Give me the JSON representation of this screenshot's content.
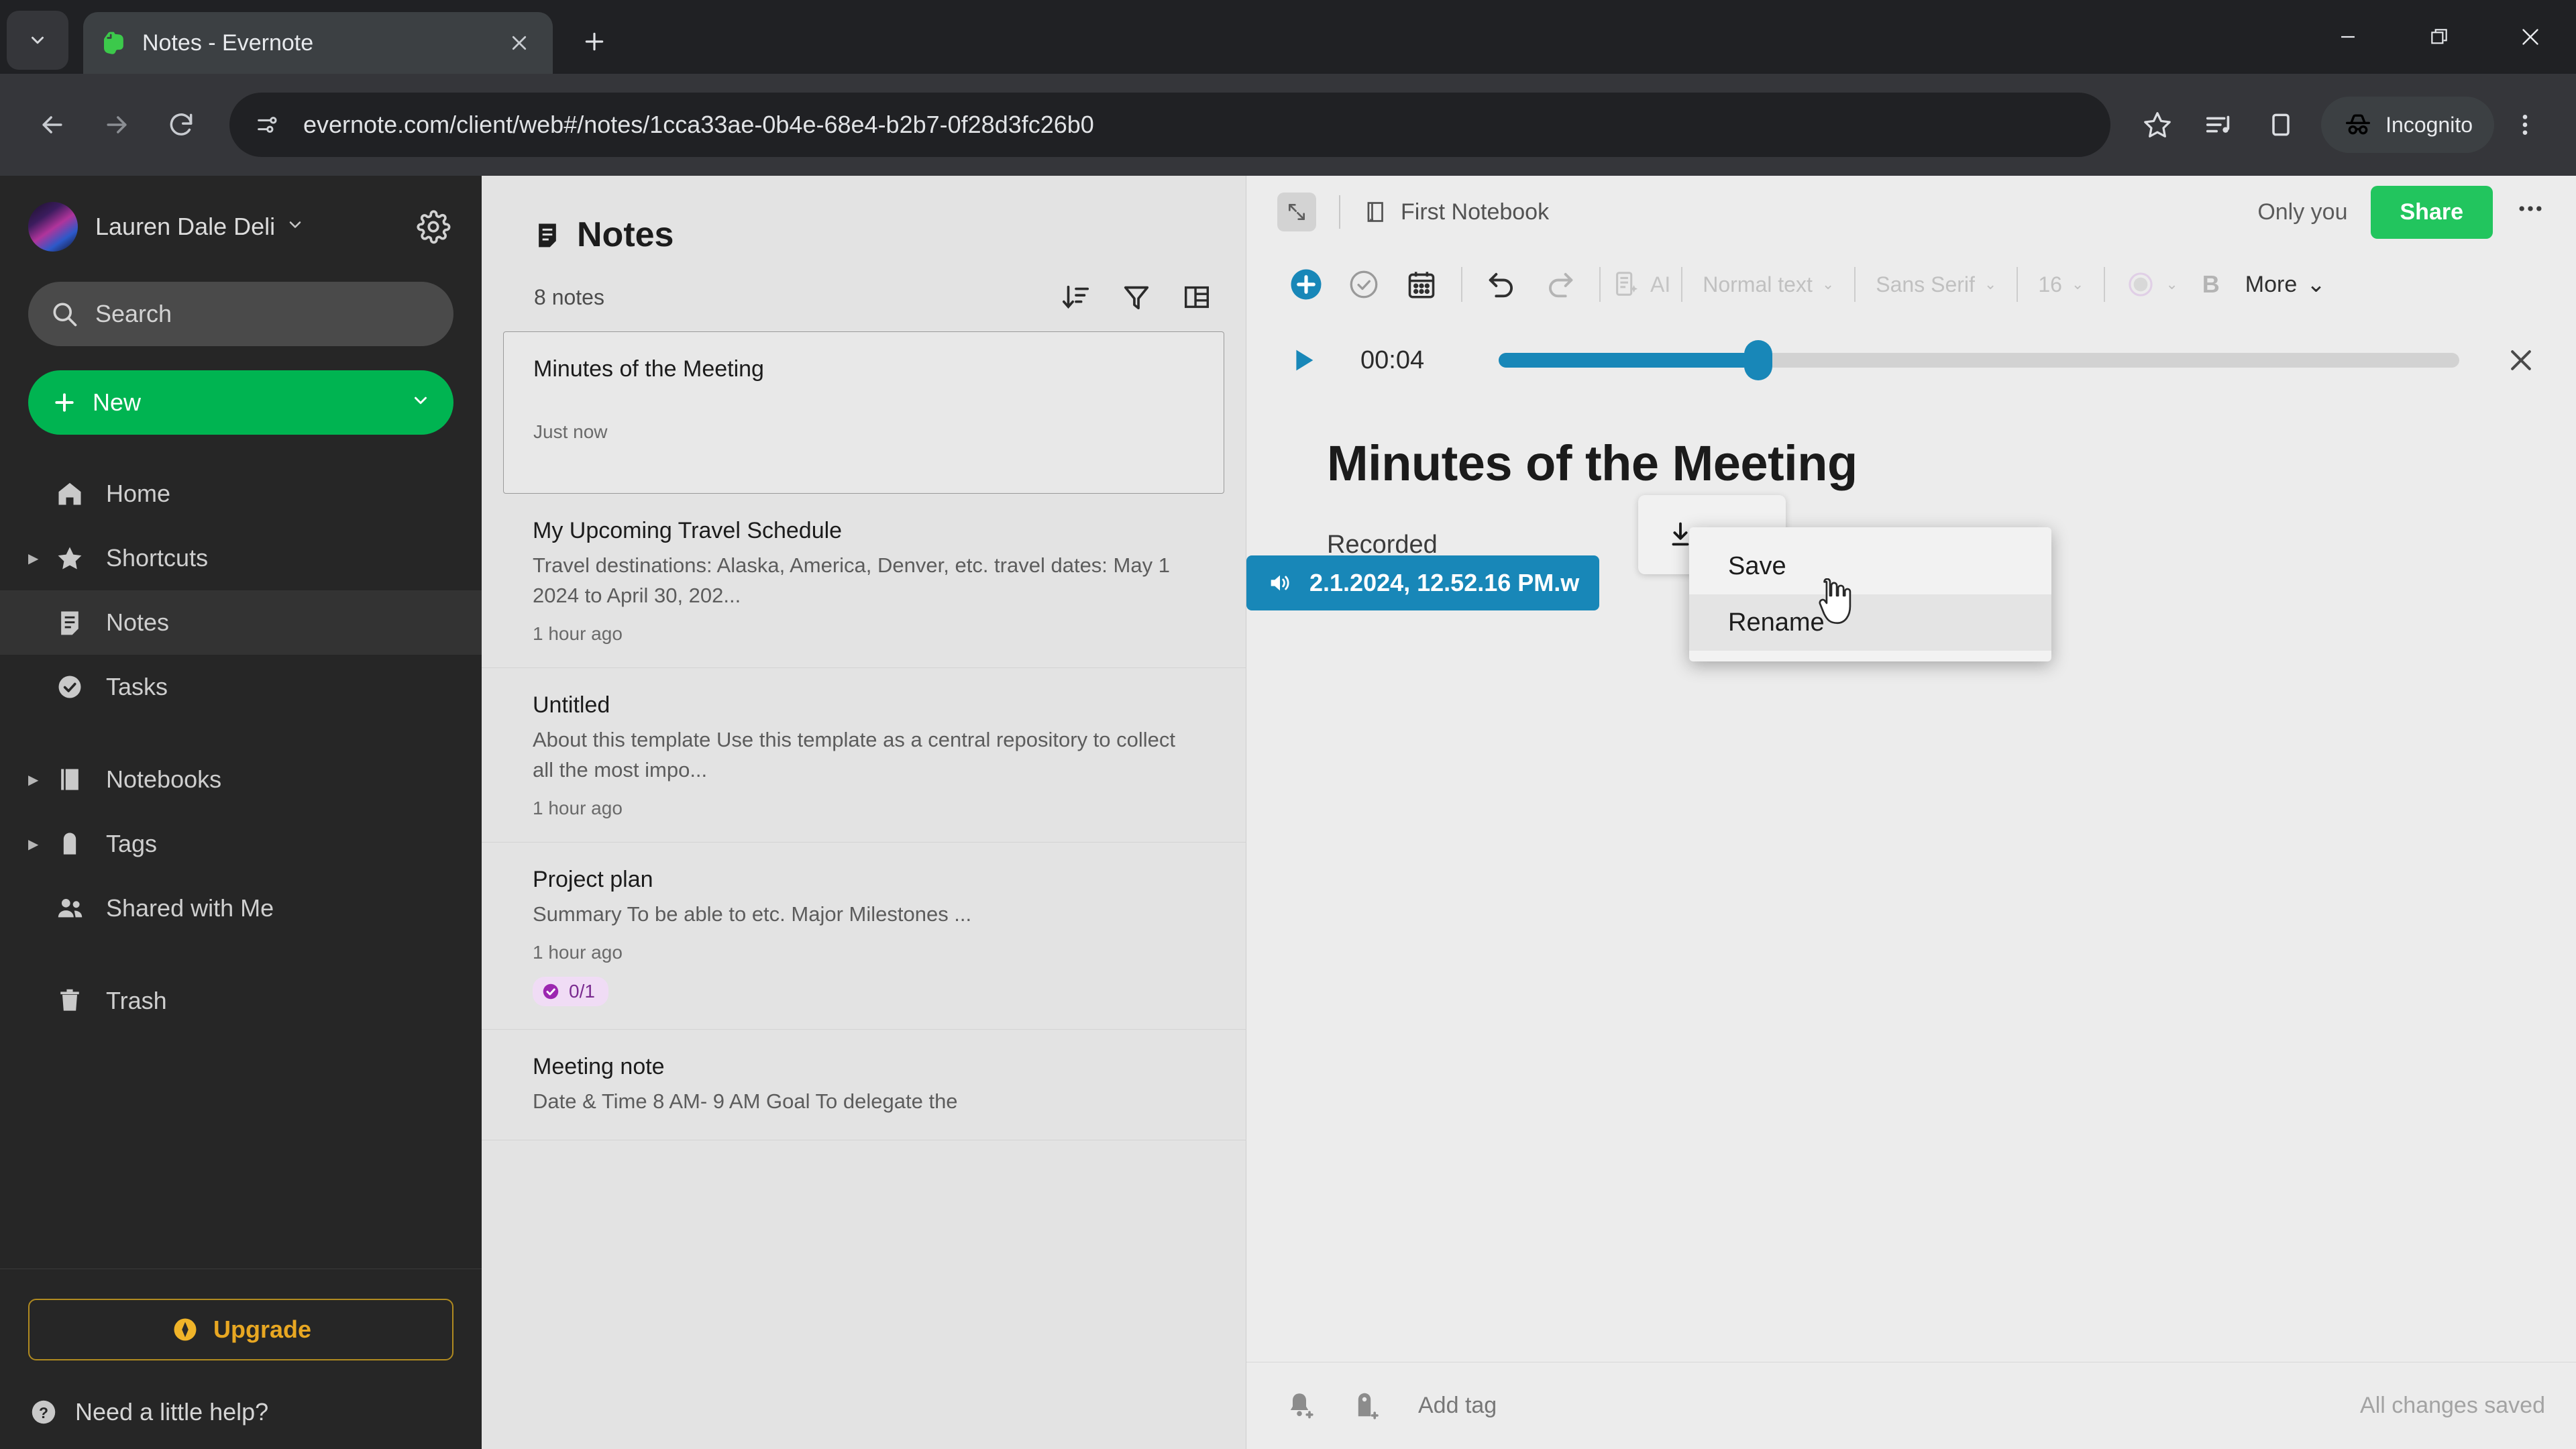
{
  "browser": {
    "tab": {
      "title": "Notes - Evernote",
      "favicon": "evernote-elephant-icon"
    },
    "new_tab_label": "+",
    "url": "evernote.com/client/web#/notes/1cca33ae-0b4e-68e4-b2b7-0f28d3fc26b0",
    "profile_label": "Incognito",
    "window_controls": {
      "minimize": "minimize-icon",
      "maximize": "maximize-icon",
      "close": "close-icon"
    }
  },
  "sidebar": {
    "user_name": "Lauren Dale Deli",
    "search_placeholder": "Search",
    "new_button": "New",
    "items": [
      {
        "label": "Home",
        "icon": "home-icon",
        "expandable": false,
        "active": false
      },
      {
        "label": "Shortcuts",
        "icon": "star-icon",
        "expandable": true,
        "active": false
      },
      {
        "label": "Notes",
        "icon": "notes-icon",
        "expandable": false,
        "active": true
      },
      {
        "label": "Tasks",
        "icon": "check-circle-icon",
        "expandable": false,
        "active": false
      },
      {
        "label": "Notebooks",
        "icon": "notebook-icon",
        "expandable": true,
        "active": false
      },
      {
        "label": "Tags",
        "icon": "tag-icon",
        "expandable": true,
        "active": false
      },
      {
        "label": "Shared with Me",
        "icon": "people-icon",
        "expandable": false,
        "active": false
      },
      {
        "label": "Trash",
        "icon": "trash-icon",
        "expandable": false,
        "active": false
      }
    ],
    "upgrade_label": "Upgrade",
    "help_label": "Need a little help?"
  },
  "notelist": {
    "title": "Notes",
    "count_label": "8 notes",
    "actions": [
      "sort-icon",
      "filter-icon",
      "layout-icon"
    ],
    "items": [
      {
        "title": "Minutes of the Meeting",
        "snippet": "",
        "time": "Just now",
        "badge": null,
        "selected": true
      },
      {
        "title": "My Upcoming Travel Schedule",
        "snippet": "Travel destinations: Alaska, America, Denver, etc. travel dates: May 1 2024 to April 30, 202...",
        "time": "1 hour ago",
        "badge": null,
        "selected": false
      },
      {
        "title": "Untitled",
        "snippet": "About this template Use this template as a central repository to collect all the most impo...",
        "time": "1 hour ago",
        "badge": null,
        "selected": false
      },
      {
        "title": "Project plan",
        "snippet": "Summary To be able to etc. Major Milestones ...",
        "time": "1 hour ago",
        "badge": "0/1",
        "selected": false
      },
      {
        "title": "Meeting note",
        "snippet": "Date & Time 8 AM- 9 AM Goal To delegate the",
        "time": "",
        "badge": null,
        "selected": false
      }
    ]
  },
  "editor": {
    "notebook": "First Notebook",
    "visibility": "Only you",
    "share_label": "Share",
    "more_label": "•••",
    "toolbar": {
      "add": "plus-icon",
      "task": "check-circle-icon",
      "calendar": "calendar-icon",
      "undo": "undo-icon",
      "redo": "redo-icon",
      "ai_label": "AI",
      "paragraph_style": "Normal text",
      "font_family": "Sans Serif",
      "font_size": "16",
      "highlight": "highlight-icon",
      "bold": "B",
      "more_label": "More"
    },
    "audio": {
      "time": "00:04",
      "progress_percent": 27,
      "play_icon": "play-icon",
      "close_icon": "close-icon"
    },
    "note_title": "Minutes of the Meeting",
    "recorded_label": "Recorded",
    "download_button": {
      "icon": "download-icon",
      "overflow": "dot-icon"
    },
    "attachment": {
      "icon": "speaker-icon",
      "name": "2.1.2024, 12.52.16 PM.w"
    },
    "context_menu": {
      "items": [
        {
          "label": "Save",
          "hover": false
        },
        {
          "label": "Rename",
          "hover": true
        }
      ]
    },
    "footer": {
      "reminder_icon": "bell-add-icon",
      "tag_icon": "tag-add-icon",
      "add_tag_label": "Add tag",
      "status": "All changes saved"
    }
  },
  "colors": {
    "evernote_green": "#00b451",
    "share_green": "#22c55e",
    "audio_blue": "#1887b8",
    "upgrade_gold": "#e8a722",
    "badge_purple": "#7a2b8f"
  }
}
